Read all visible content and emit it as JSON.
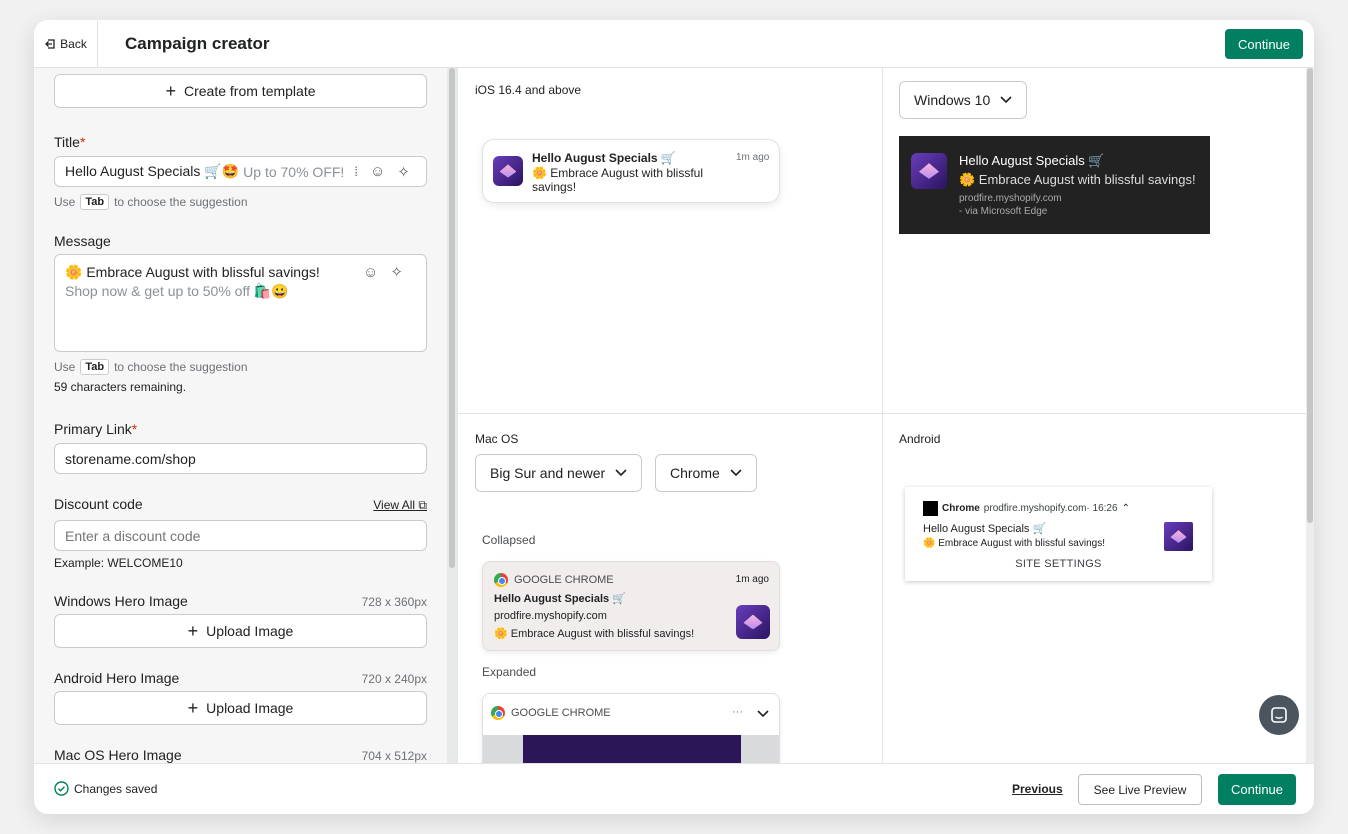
{
  "header": {
    "back_label": "Back",
    "title": "Campaign creator",
    "continue_label": "Continue"
  },
  "form": {
    "template_button": "Create from template",
    "title_label": "Title",
    "title_value": "Hello August Specials 🛒🤩",
    "title_suggestion": "Up to 70% OFF!",
    "tab_key": "Tab",
    "hint_use": "Use",
    "hint_suffix": "to choose the suggestion",
    "message_label": "Message",
    "message_value": "🌼 Embrace August with blissful savings!",
    "message_suggestion": "Shop now & get up to 50% off 🛍️😀",
    "chars_remaining": "59 characters remaining.",
    "primary_link_label": "Primary Link",
    "primary_link_value": "storename.com/shop",
    "discount_label": "Discount code",
    "view_all": "View All",
    "discount_placeholder": "Enter a discount code",
    "discount_example": "Example: WELCOME10",
    "windows_hero_label": "Windows Hero Image",
    "windows_hero_size": "728 x 360px",
    "upload_label": "Upload Image",
    "android_hero_label": "Android Hero Image",
    "android_hero_size": "720 x 240px",
    "mac_hero_label": "Mac OS Hero Image",
    "mac_hero_size": "704 x 512px"
  },
  "preview": {
    "ios_title": "iOS 16.4 and above",
    "notif_title": "Hello August Specials 🛒",
    "notif_body": "🌼 Embrace August with blissful savings!",
    "ios_time": "1m ago",
    "windows_select": "Windows 10",
    "windows_site": "prodfire.myshopify.com",
    "windows_via": "- via Microsoft Edge",
    "mac_title": "Mac OS",
    "mac_version_select": "Big Sur and newer",
    "mac_browser_select": "Chrome",
    "collapsed_label": "Collapsed",
    "expanded_label": "Expanded",
    "chrome_app": "GOOGLE CHROME",
    "chrome_time": "1m ago",
    "chrome_site": "prodfire.myshopify.com",
    "more_dots": "···",
    "android_title": "Android",
    "android_app": "Chrome",
    "android_meta": "prodfire.myshopify.com· 16:26",
    "android_settings": "SITE SETTINGS"
  },
  "footer": {
    "saved": "Changes saved",
    "previous": "Previous",
    "live_preview": "See Live Preview",
    "continue_label": "Continue"
  },
  "colors": {
    "primary": "#008060",
    "required": "#d72c0d"
  },
  "icons": [
    "back-icon",
    "plus-icon",
    "emoji-icon",
    "sparkle-icon",
    "cursor-icon",
    "external-link-icon",
    "chevron-down-icon",
    "chrome-icon",
    "check-circle-icon",
    "chat-icon"
  ]
}
